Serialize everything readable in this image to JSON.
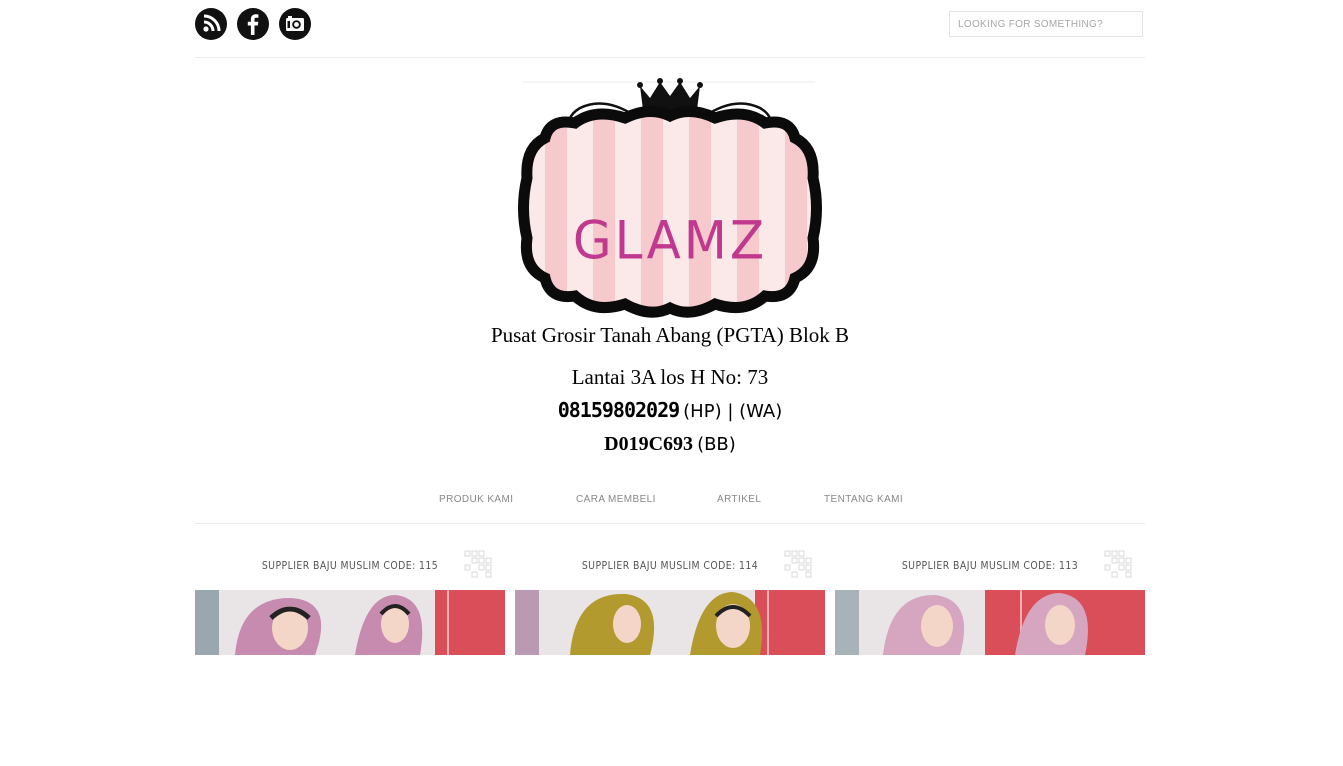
{
  "header": {
    "social": [
      {
        "name": "rss-icon"
      },
      {
        "name": "facebook-icon"
      },
      {
        "name": "camera-icon"
      }
    ],
    "search_placeholder": "LOOKING FOR SOMETHING?"
  },
  "banner": {
    "logo_text": "GLAMZ",
    "address_line1": "Pusat Grosir Tanah Abang (PGTA) Blok B",
    "address_line2": "Lantai 3A los H No: 73",
    "phone_number": "08159802029",
    "phone_suffix": "(HP) | (WA)",
    "bb_pin": "D019C693",
    "bb_suffix": "(BB)"
  },
  "nav": [
    {
      "label": "PRODUK KAMI"
    },
    {
      "label": "CARA MEMBELI"
    },
    {
      "label": "ARTIKEL"
    },
    {
      "label": "TENTANG KAMI"
    }
  ],
  "products": [
    {
      "title": "SUPPLIER BAJU MUSLIM CODE: 115",
      "hijab_color": "#c78bb0"
    },
    {
      "title": "SUPPLIER BAJU MUSLIM CODE: 114",
      "hijab_color": "#b39a2f"
    },
    {
      "title": "SUPPLIER BAJU MUSLIM CODE: 113",
      "hijab_color": "#d6a6c0"
    }
  ]
}
